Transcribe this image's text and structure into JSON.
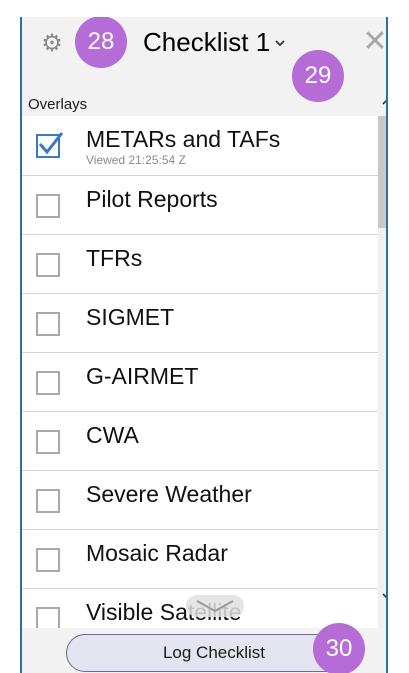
{
  "header": {
    "title": "Checklist 1",
    "settings_icon": "gear-icon",
    "dropdown_icon": "chevron-down-icon",
    "close_icon": "close-icon",
    "close_glyph": "✕"
  },
  "badges": {
    "settings": "28",
    "close": "29",
    "log": "30"
  },
  "section": {
    "label": "Overlays"
  },
  "items": [
    {
      "label": "METARs and TAFs",
      "sub": "Viewed 21:25:54 Z",
      "checked": true
    },
    {
      "label": "Pilot Reports",
      "checked": false
    },
    {
      "label": "TFRs",
      "checked": false
    },
    {
      "label": "SIGMET",
      "checked": false
    },
    {
      "label": "G-AIRMET",
      "checked": false
    },
    {
      "label": "CWA",
      "checked": false
    },
    {
      "label": "Severe Weather",
      "checked": false
    },
    {
      "label": "Mosaic Radar",
      "checked": false
    },
    {
      "label": "Visible Satellite",
      "checked": false
    }
  ],
  "footer": {
    "button_label": "Log Checklist"
  },
  "colors": {
    "accent": "#3a78c9",
    "badge": "#b56cd6",
    "frame": "#2d6f9e",
    "button_bg": "#e4e4f1"
  }
}
